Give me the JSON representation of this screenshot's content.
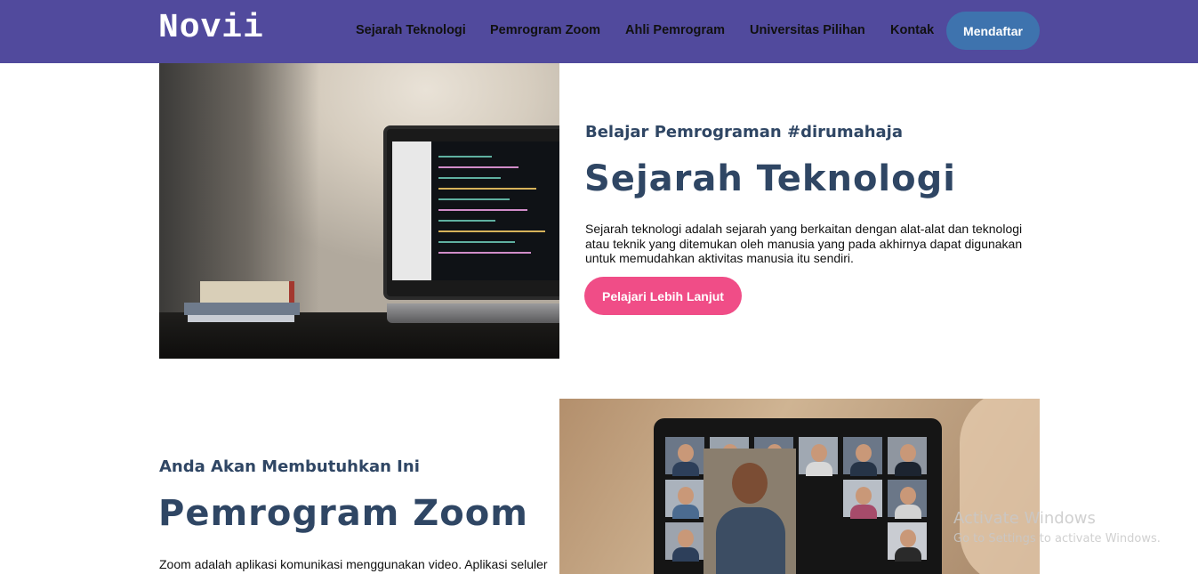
{
  "navbar": {
    "brand": "Novii",
    "links": [
      "Sejarah Teknologi",
      "Pemrogram Zoom",
      "Ahli Pemrogram",
      "Universitas Pilihan",
      "Kontak"
    ],
    "signup_label": "Mendaftar",
    "bg_color": "#514a9d",
    "signup_color": "#3e73ae"
  },
  "hero": {
    "eyebrow": "Belajar Pemrograman #dirumahaja",
    "title": "Sejarah Teknologi",
    "description": "Sejarah teknologi adalah sejarah yang berkaitan dengan alat-alat dan teknologi atau teknik yang ditemukan oleh manusia yang pada akhirnya dapat digunakan untuk memudahkan aktivitas manusia itu sendiri.",
    "cta_label": "Pelajari Lebih Lanjut",
    "cta_color": "#f04d87",
    "image": "laptop-on-desk-photo"
  },
  "section2": {
    "eyebrow": "Anda Akan Membutuhkan Ini",
    "title": "Pemrogram Zoom",
    "description": "Zoom adalah aplikasi komunikasi menggunakan video. Aplikasi seluler",
    "image": "video-conference-laptop-photo"
  },
  "watermark": {
    "title": "Activate Windows",
    "subtitle": "Go to Settings to activate Windows."
  }
}
